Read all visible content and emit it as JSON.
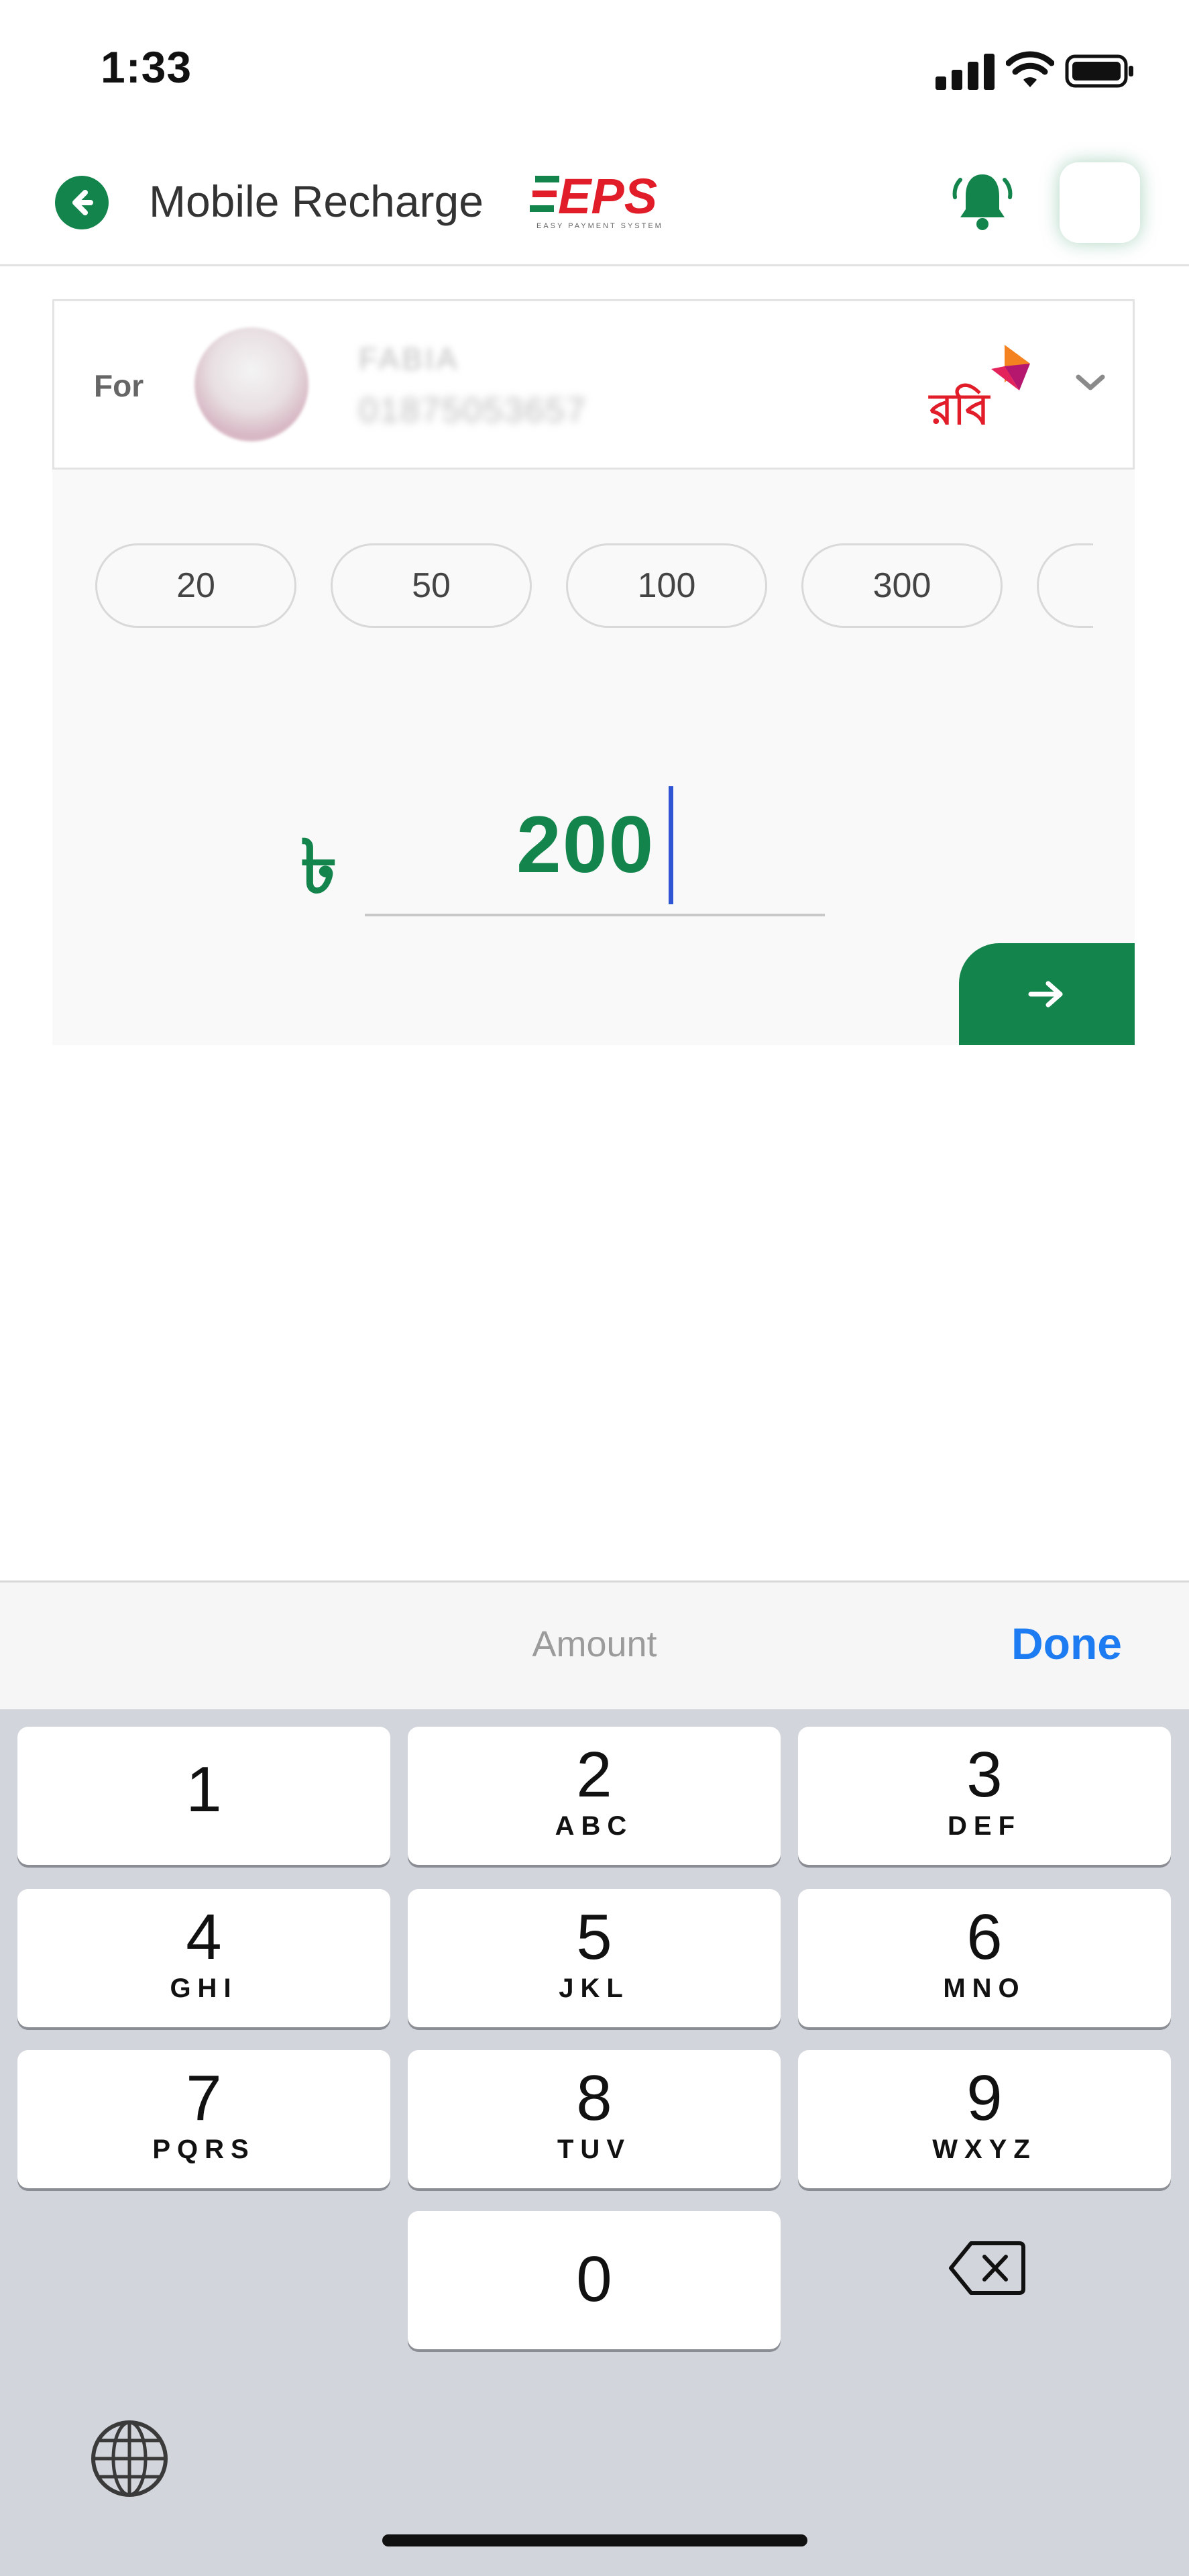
{
  "status_bar": {
    "time": "1:33"
  },
  "header": {
    "title": "Mobile Recharge",
    "brand_logo_text": "EPS",
    "brand_logo_subtitle": "EASY PAYMENT SYSTEM",
    "accent_color": "#13854c"
  },
  "contact": {
    "for_label": "For",
    "name": "FABIA",
    "number": "01875053657",
    "operator": "রবি"
  },
  "quick_amounts": [
    "20",
    "50",
    "100",
    "300"
  ],
  "amount": {
    "currency_symbol": "৳",
    "value": "200"
  },
  "keyboard": {
    "accessory_title": "Amount",
    "done_label": "Done",
    "keys": [
      {
        "digit": "1",
        "letters": ""
      },
      {
        "digit": "2",
        "letters": "ABC"
      },
      {
        "digit": "3",
        "letters": "DEF"
      },
      {
        "digit": "4",
        "letters": "GHI"
      },
      {
        "digit": "5",
        "letters": "JKL"
      },
      {
        "digit": "6",
        "letters": "MNO"
      },
      {
        "digit": "7",
        "letters": "PQRS"
      },
      {
        "digit": "8",
        "letters": "TUV"
      },
      {
        "digit": "9",
        "letters": "WXYZ"
      },
      {
        "digit": "0",
        "letters": ""
      }
    ]
  },
  "icons": {
    "back": "back-arrow-icon",
    "notification": "bell-icon",
    "next": "arrow-right-icon",
    "backspace": "backspace-icon",
    "globe": "globe-icon"
  }
}
